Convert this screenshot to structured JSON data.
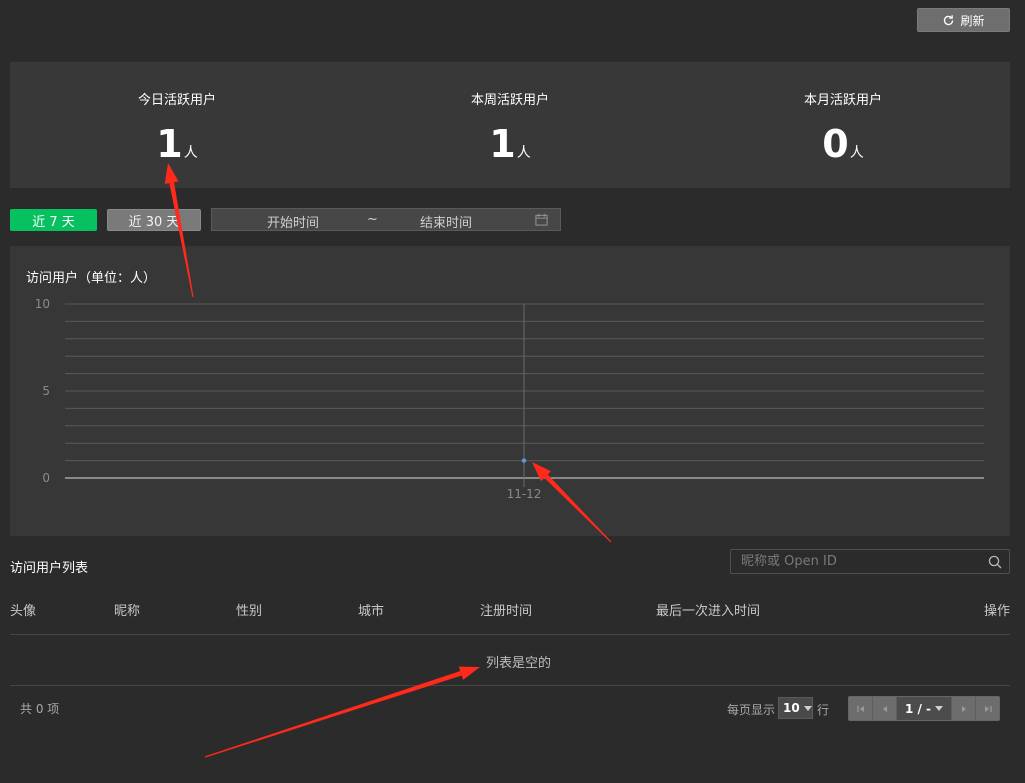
{
  "toolbar": {
    "refresh_label": "刷新",
    "refresh_icon": "refresh-icon"
  },
  "stats": [
    {
      "label": "今日活跃用户",
      "value": "1",
      "unit": "人"
    },
    {
      "label": "本周活跃用户",
      "value": "1",
      "unit": "人"
    },
    {
      "label": "本月活跃用户",
      "value": "0",
      "unit": "人"
    }
  ],
  "range": {
    "last7_label": "近 7 天",
    "last30_label": "近 30 天",
    "start_placeholder": "开始时间",
    "separator": "~",
    "end_placeholder": "结束时间",
    "active_color": "#07c160"
  },
  "chart_data": {
    "type": "line",
    "title": "访问用户（单位：人）",
    "categories": [
      "11-12"
    ],
    "series": [
      {
        "values": [
          1
        ]
      }
    ],
    "ylim": [
      0,
      10
    ],
    "yticks": [
      "0",
      "5",
      "10"
    ],
    "grid": true,
    "color": "#5b9bd5"
  },
  "list": {
    "title": "访问用户列表",
    "search_placeholder": "昵称或 Open ID",
    "columns": [
      "头像",
      "昵称",
      "性别",
      "城市",
      "注册时间",
      "最后一次进入时间",
      "操作"
    ],
    "empty_text": "列表是空的",
    "total_text": "共 0 项"
  },
  "pagination": {
    "per_page_label": "每页显示",
    "per_page_value": "10",
    "per_page_suffix": "行",
    "page_text": "1 / -"
  },
  "annotations": {
    "arrow_color": "#ff2a1a"
  }
}
